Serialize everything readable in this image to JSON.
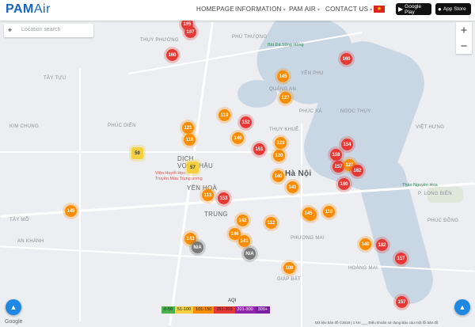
{
  "header": {
    "logo_main": "PAM",
    "logo_air": "Air",
    "nav": [
      {
        "label": "HOMEPAGE",
        "caret": ""
      },
      {
        "label": "INFORMATION",
        "caret": "▾"
      },
      {
        "label": "PAM AIR",
        "caret": "▾"
      },
      {
        "label": "CONTACT US",
        "caret": "▾"
      }
    ],
    "flag_star": "★",
    "google_play": "Google Play",
    "app_store": "App Store"
  },
  "search": {
    "placeholder": "Location search",
    "icon": "⌖"
  },
  "zoom": {
    "in": "+",
    "out": "−"
  },
  "fab_icon": "▲",
  "legend": {
    "label": "AQI",
    "ranges": [
      {
        "label": "0-50",
        "color": "#4caf50"
      },
      {
        "label": "51-100",
        "color": "#f4d03f"
      },
      {
        "label": "101-150",
        "color": "#fb8c00"
      },
      {
        "label": "151-200",
        "color": "#e53935"
      },
      {
        "label": "201-300",
        "color": "#8e24aa"
      },
      {
        "label": "300+",
        "color": "#7b1fa2"
      }
    ]
  },
  "attribution": "Dữ liệu bản đồ ©2019  |  1 km  ___  Điều khoản sử dụng  Báo cáo một lỗi bản đồ",
  "google": "Google",
  "places": {
    "thuy_phuong": "THỤY PHƯƠNG",
    "phu_thuong": "PHÚ THƯỢNG",
    "tay_tuu": "TÂY TỰU",
    "kim_chung": "KIM CHUNG",
    "phuc_dien": "PHÚC DIỄN",
    "dich_vong_hau": "DỊCH\nVỌNG HẬU",
    "yen_hoa": "YÊN HOÀ",
    "ha_noi": "Hà Nội",
    "trung": "TRUNG",
    "quang_an": "QUẢNG AN",
    "yen_phu": "YÊN PHỤ",
    "thuy_khue": "THỤY KHUÊ",
    "phuc_xa": "PHÚC XÁ",
    "tay_mo": "TÂY MỖ",
    "an_khanh": "AN KHÁNH",
    "phuong_mai": "PHƯƠNG MAI",
    "viet_hung": "VIỆT HƯNG",
    "phuc_dong": "PHÚC ĐỒNG",
    "long_bien": "P. LONG BIÊN",
    "ngoc_thuy": "NGỌC THỤY",
    "bai_da": "Bãi Đá Sông Hồng",
    "thao_nguyen": "Thảo Nguyên Hoa",
    "vien_huyet_hoc": "Viện Huyết Học\nTruyền Máu Trung ương",
    "giap_bat": "GIÁP BÁT",
    "hoang_mai": "HOÀNG MAI"
  },
  "markers": [
    {
      "value": "165",
      "level": "unh"
    },
    {
      "value": "167",
      "level": "unh"
    },
    {
      "value": "160",
      "level": "unh"
    },
    {
      "value": "160",
      "level": "unh"
    },
    {
      "value": "145",
      "level": "sens"
    },
    {
      "value": "127",
      "level": "sens"
    },
    {
      "value": "119",
      "level": "sens"
    },
    {
      "value": "152",
      "level": "unh"
    },
    {
      "value": "121",
      "level": "sens"
    },
    {
      "value": "118",
      "level": "sens"
    },
    {
      "value": "140",
      "level": "sens"
    },
    {
      "value": "151",
      "level": "unh"
    },
    {
      "value": "123",
      "level": "sens"
    },
    {
      "value": "120",
      "level": "sens"
    },
    {
      "value": "154",
      "level": "unh"
    },
    {
      "value": "158",
      "level": "unh"
    },
    {
      "value": "157",
      "level": "unh"
    },
    {
      "value": "127",
      "level": "sens"
    },
    {
      "value": "162",
      "level": "unh"
    },
    {
      "value": "50",
      "level": "mod"
    },
    {
      "value": "57",
      "level": "mod"
    },
    {
      "value": "153",
      "level": "unh"
    },
    {
      "value": "113",
      "level": "sens"
    },
    {
      "value": "140",
      "level": "sens"
    },
    {
      "value": "141",
      "level": "sens"
    },
    {
      "value": "160",
      "level": "unh"
    },
    {
      "value": "145",
      "level": "sens"
    },
    {
      "value": "110",
      "level": "sens"
    },
    {
      "value": "125",
      "level": "sens"
    },
    {
      "value": "143",
      "level": "sens"
    },
    {
      "value": "112",
      "level": "sens"
    },
    {
      "value": "142",
      "level": "sens"
    },
    {
      "value": "N/A",
      "level": "na"
    },
    {
      "value": "141",
      "level": "sens"
    },
    {
      "value": "N/A",
      "level": "na"
    },
    {
      "value": "140",
      "level": "sens"
    },
    {
      "value": "182",
      "level": "unh"
    },
    {
      "value": "157",
      "level": "unh"
    },
    {
      "value": "108",
      "level": "sens"
    },
    {
      "value": "157",
      "level": "unh"
    },
    {
      "value": "146",
      "level": "sens"
    },
    {
      "value": "145",
      "level": "sens"
    }
  ]
}
